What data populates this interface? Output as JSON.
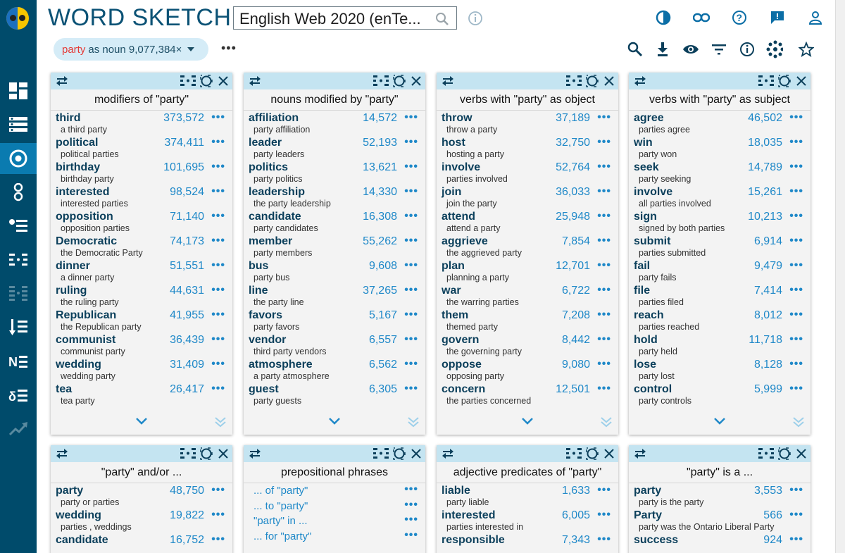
{
  "app": {
    "title": "WORD SKETCH"
  },
  "corpus": {
    "value": "English Web 2020 (enTe..."
  },
  "query": {
    "lemma": "party",
    "rest": "as noun 9,077,384×",
    "more": "•••"
  },
  "colors": {
    "sidebar": "#004b6b",
    "sidebar_active": "#0a7bb0",
    "accent": "#1e88c8",
    "panel_header": "#c4e4f1",
    "chip": "#d5ecf7",
    "lemma": "#e53935"
  },
  "sidebar_icons": [
    "dashboard-icon",
    "list-icon",
    "target-icon",
    "dots-vertical-icon",
    "bullet-list-icon",
    "wordsketch-icon",
    "wordsketch-diff-icon",
    "sort-icon",
    "ne-icon",
    "parconc-icon",
    "trends-icon"
  ],
  "top_icons": [
    "theme-icon",
    "link-icon",
    "help-icon",
    "feedback-icon",
    "user-icon"
  ],
  "toolbar_icons": [
    "zoom-icon",
    "download-icon",
    "view-icon",
    "filter-icon",
    "info-icon",
    "cluster-icon",
    "star-icon"
  ],
  "panels": [
    {
      "title": "modifiers of \"party\"",
      "rows": [
        {
          "word": "third",
          "freq": "373,572",
          "colloc": "a third party"
        },
        {
          "word": "political",
          "freq": "374,411",
          "colloc": "political parties"
        },
        {
          "word": "birthday",
          "freq": "101,695",
          "colloc": "birthday party"
        },
        {
          "word": "interested",
          "freq": "98,524",
          "colloc": "interested parties"
        },
        {
          "word": "opposition",
          "freq": "71,140",
          "colloc": "opposition parties"
        },
        {
          "word": "Democratic",
          "freq": "74,173",
          "colloc": "the Democratic Party"
        },
        {
          "word": "dinner",
          "freq": "51,551",
          "colloc": "a dinner party"
        },
        {
          "word": "ruling",
          "freq": "44,631",
          "colloc": "the ruling party"
        },
        {
          "word": "Republican",
          "freq": "41,955",
          "colloc": "the Republican party"
        },
        {
          "word": "communist",
          "freq": "36,439",
          "colloc": "communist party"
        },
        {
          "word": "wedding",
          "freq": "31,409",
          "colloc": "wedding party"
        },
        {
          "word": "tea",
          "freq": "26,417",
          "colloc": "tea party"
        }
      ]
    },
    {
      "title": "nouns modified by \"party\"",
      "rows": [
        {
          "word": "affiliation",
          "freq": "14,572",
          "colloc": "party affiliation"
        },
        {
          "word": "leader",
          "freq": "52,193",
          "colloc": "party leaders"
        },
        {
          "word": "politics",
          "freq": "13,621",
          "colloc": "party politics"
        },
        {
          "word": "leadership",
          "freq": "14,330",
          "colloc": "the party leadership"
        },
        {
          "word": "candidate",
          "freq": "16,308",
          "colloc": "party candidates"
        },
        {
          "word": "member",
          "freq": "55,262",
          "colloc": "party members"
        },
        {
          "word": "bus",
          "freq": "9,608",
          "colloc": "party bus"
        },
        {
          "word": "line",
          "freq": "37,265",
          "colloc": "the party line"
        },
        {
          "word": "favors",
          "freq": "5,167",
          "colloc": "party favors"
        },
        {
          "word": "vendor",
          "freq": "6,557",
          "colloc": "third party vendors"
        },
        {
          "word": "atmosphere",
          "freq": "6,562",
          "colloc": "a party atmosphere"
        },
        {
          "word": "guest",
          "freq": "6,305",
          "colloc": "party guests"
        }
      ]
    },
    {
      "title": "verbs with \"party\" as object",
      "rows": [
        {
          "word": "throw",
          "freq": "37,189",
          "colloc": "throw a party"
        },
        {
          "word": "host",
          "freq": "32,750",
          "colloc": "hosting a party"
        },
        {
          "word": "involve",
          "freq": "52,764",
          "colloc": "parties involved"
        },
        {
          "word": "join",
          "freq": "36,033",
          "colloc": "join the party"
        },
        {
          "word": "attend",
          "freq": "25,948",
          "colloc": "attend a party"
        },
        {
          "word": "aggrieve",
          "freq": "7,854",
          "colloc": "the aggrieved party"
        },
        {
          "word": "plan",
          "freq": "12,701",
          "colloc": "planning a party"
        },
        {
          "word": "war",
          "freq": "6,722",
          "colloc": "the warring parties"
        },
        {
          "word": "them",
          "freq": "7,208",
          "colloc": "themed party"
        },
        {
          "word": "govern",
          "freq": "8,442",
          "colloc": "the governing party"
        },
        {
          "word": "oppose",
          "freq": "9,080",
          "colloc": "opposing party"
        },
        {
          "word": "concern",
          "freq": "12,501",
          "colloc": "the parties concerned"
        }
      ]
    },
    {
      "title": "verbs with \"party\" as subject",
      "rows": [
        {
          "word": "agree",
          "freq": "46,502",
          "colloc": "parties agree"
        },
        {
          "word": "win",
          "freq": "18,035",
          "colloc": "party won"
        },
        {
          "word": "seek",
          "freq": "14,789",
          "colloc": "party seeking"
        },
        {
          "word": "involve",
          "freq": "15,261",
          "colloc": "all parties involved"
        },
        {
          "word": "sign",
          "freq": "10,213",
          "colloc": "signed by both parties"
        },
        {
          "word": "submit",
          "freq": "6,914",
          "colloc": "parties submitted"
        },
        {
          "word": "fail",
          "freq": "9,479",
          "colloc": "party fails"
        },
        {
          "word": "file",
          "freq": "7,414",
          "colloc": "parties filed"
        },
        {
          "word": "reach",
          "freq": "8,012",
          "colloc": "parties reached"
        },
        {
          "word": "hold",
          "freq": "11,718",
          "colloc": "party held"
        },
        {
          "word": "lose",
          "freq": "8,128",
          "colloc": "party lost"
        },
        {
          "word": "control",
          "freq": "5,999",
          "colloc": "party controls"
        }
      ]
    },
    {
      "title": "\"party\" and/or ...",
      "rows": [
        {
          "word": "party",
          "freq": "48,750",
          "colloc": "party or parties"
        },
        {
          "word": "wedding",
          "freq": "19,822",
          "colloc": "parties , weddings"
        },
        {
          "word": "candidate",
          "freq": "16,752",
          "colloc": ""
        }
      ]
    },
    {
      "title": "prepositional phrases",
      "links": [
        "... of \"party\"",
        "... to \"party\"",
        "\"party\" in ...",
        "... for \"party\""
      ]
    },
    {
      "title": "adjective predicates of \"party\"",
      "rows": [
        {
          "word": "liable",
          "freq": "1,633",
          "colloc": "party liable"
        },
        {
          "word": "interested",
          "freq": "6,005",
          "colloc": "parties interested in"
        },
        {
          "word": "responsible",
          "freq": "7,343",
          "colloc": ""
        }
      ]
    },
    {
      "title": "\"party\" is a ...",
      "rows": [
        {
          "word": "party",
          "freq": "3,553",
          "colloc": "party is the party"
        },
        {
          "word": "Party",
          "freq": "566",
          "colloc": "party was the Ontario Liberal Party"
        },
        {
          "word": "success",
          "freq": "924",
          "colloc": ""
        }
      ]
    }
  ]
}
